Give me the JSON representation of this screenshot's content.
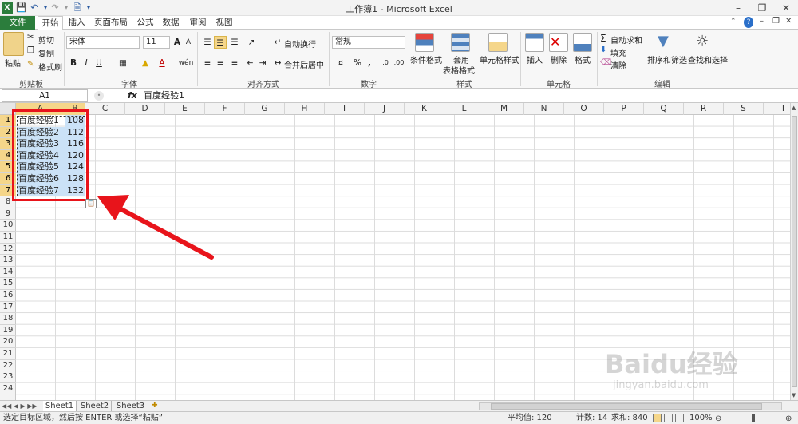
{
  "window": {
    "title": "工作簿1 - Microsoft Excel"
  },
  "tabs": {
    "file": "文件",
    "home": "开始",
    "insert": "插入",
    "page_layout": "页面布局",
    "formulas": "公式",
    "data": "数据",
    "review": "审阅",
    "view": "视图"
  },
  "clipboard": {
    "paste": "粘贴",
    "cut": "剪切",
    "copy": "复制",
    "format_painter": "格式刷",
    "group": "剪贴板"
  },
  "font": {
    "name": "宋体",
    "size": "11",
    "bold": "B",
    "italic": "I",
    "underline": "U",
    "group": "字体",
    "grow": "A",
    "shrink": "A",
    "font_color": "A",
    "wen": "wén"
  },
  "alignment": {
    "wrap": "自动换行",
    "merge": "合并后居中",
    "group": "对齐方式"
  },
  "number": {
    "format": "常规",
    "percent": "%",
    "comma": ",",
    "dec_inc": ".0",
    "dec_dec": ".00",
    "group": "数字"
  },
  "styles": {
    "conditional": "条件格式",
    "table_line1": "套用",
    "table_line2": "表格格式",
    "cell_styles": "单元格样式",
    "group": "样式"
  },
  "cells_grp": {
    "insert": "插入",
    "delete": "删除",
    "format": "格式",
    "group": "单元格"
  },
  "editing": {
    "autosum": "自动求和",
    "fill": "填充",
    "clear": "清除",
    "sort": "排序和筛选",
    "find": "查找和选择",
    "group": "编辑",
    "sigma": "Σ"
  },
  "formula_bar": {
    "name_box": "A1",
    "fx": "fx",
    "value": "百度经验1"
  },
  "columns": [
    "A",
    "B",
    "C",
    "D",
    "E",
    "F",
    "G",
    "H",
    "I",
    "J",
    "K",
    "L",
    "M",
    "N",
    "O",
    "P",
    "Q",
    "R",
    "S",
    "T"
  ],
  "rows": [
    "1",
    "2",
    "3",
    "4",
    "5",
    "6",
    "7",
    "8",
    "9",
    "10",
    "11",
    "12",
    "13",
    "14",
    "15",
    "16",
    "17",
    "18",
    "19",
    "20",
    "21",
    "22",
    "23",
    "24"
  ],
  "data_rows": [
    {
      "a": "百度经验1",
      "b": "108"
    },
    {
      "a": "百度经验2",
      "b": "112"
    },
    {
      "a": "百度经验3",
      "b": "116"
    },
    {
      "a": "百度经验4",
      "b": "120"
    },
    {
      "a": "百度经验5",
      "b": "124"
    },
    {
      "a": "百度经验6",
      "b": "128"
    },
    {
      "a": "百度经验7",
      "b": "132"
    }
  ],
  "sheets": [
    "Sheet1",
    "Sheet2",
    "Sheet3"
  ],
  "status": {
    "message": "选定目标区域，然后按 ENTER 或选择“粘贴”",
    "average": "平均值: 120",
    "count": "计数: 14",
    "sum": "求和: 840",
    "zoom": "100%"
  },
  "watermark": {
    "brand": "Baidu经验",
    "url": "jingyan.baidu.com"
  },
  "colors": {
    "file_tab": "#2b7d3c",
    "highlight": "#cbe2f7",
    "annotation": "#e8141b",
    "selected_header": "#f5d68a"
  }
}
